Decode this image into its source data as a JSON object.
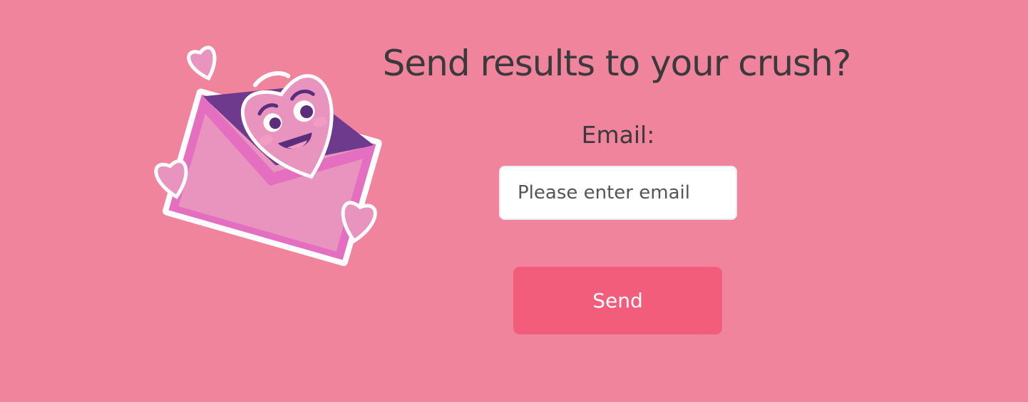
{
  "form": {
    "title": "Send results to your crush?",
    "email_label": "Email:",
    "email_placeholder": "Please enter email",
    "email_value": "",
    "send_label": "Send"
  },
  "illustration": {
    "icon": "love-letter-heart-envelope-icon"
  },
  "colors": {
    "background": "#f0849c",
    "button": "#f25d7c",
    "text": "#3a3a3c",
    "envelope": "#e993bf",
    "envelope_dark": "#6d3a8e",
    "heart": "#e48bbd"
  }
}
